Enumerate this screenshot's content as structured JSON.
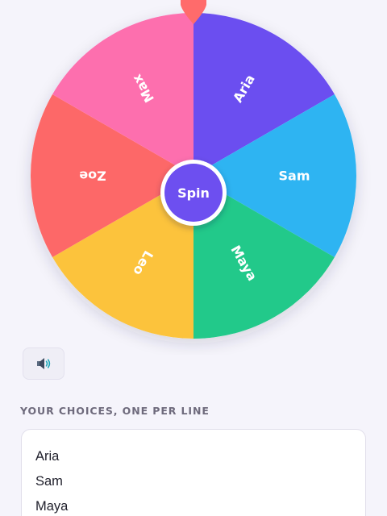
{
  "wheel": {
    "segments": [
      {
        "label": "Aria",
        "color": "#6b4ef0"
      },
      {
        "label": "Sam",
        "color": "#2eb4f2"
      },
      {
        "label": "Maya",
        "color": "#22c98a"
      },
      {
        "label": "Leo",
        "color": "#fcc33c"
      },
      {
        "label": "Zoe",
        "color": "#fd6868"
      },
      {
        "label": "Max",
        "color": "#fd6fae"
      }
    ],
    "spin_label": "Spin",
    "spin_color": "#6d4ff0",
    "pointer_color": "#ff6b6b"
  },
  "sound": {
    "icon": "speaker-icon"
  },
  "choices": {
    "label": "YOUR CHOICES, ONE PER LINE",
    "lines": [
      "Aria",
      "Sam",
      "Maya"
    ]
  }
}
